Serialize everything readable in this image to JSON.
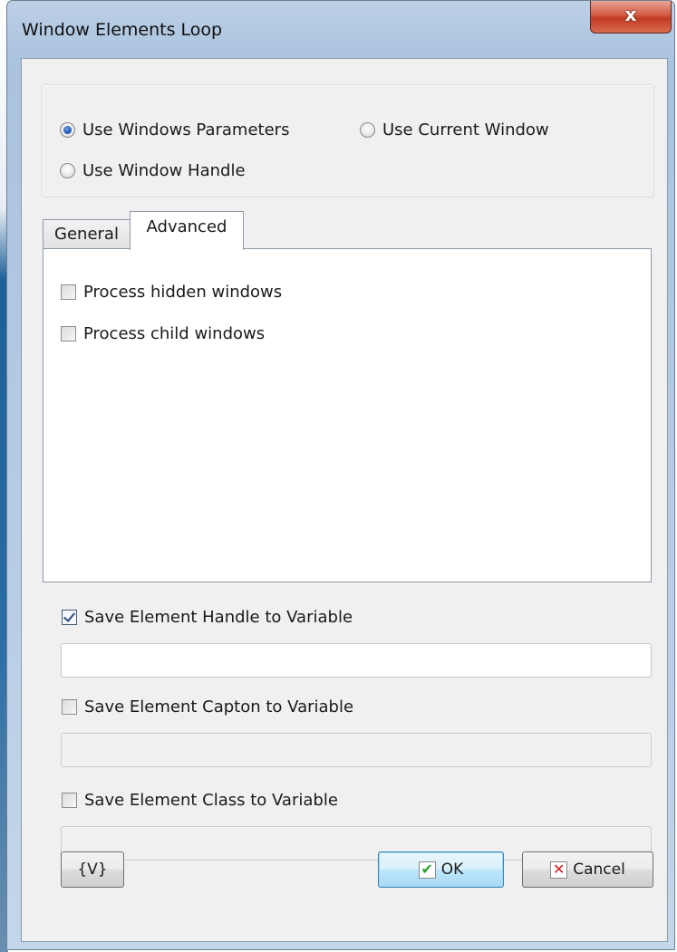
{
  "window": {
    "title": "Window Elements Loop",
    "close_label": "x"
  },
  "mode": {
    "options": [
      {
        "label": "Use Windows Parameters",
        "checked": true
      },
      {
        "label": "Use Current Window",
        "checked": false
      },
      {
        "label": "Use Window Handle",
        "checked": false
      }
    ]
  },
  "tabs": [
    {
      "label": "General",
      "active": false
    },
    {
      "label": "Advanced",
      "active": true
    }
  ],
  "advanced": {
    "options": [
      {
        "label": "Process hidden windows",
        "checked": false
      },
      {
        "label": "Process child windows",
        "checked": false
      }
    ]
  },
  "save": {
    "handle": {
      "label": "Save Element Handle to Variable",
      "checked": true,
      "value": ""
    },
    "caption": {
      "label": "Save Element Capton to Variable",
      "checked": false,
      "value": ""
    },
    "class": {
      "label": "Save Element Class to Variable",
      "checked": false,
      "value": ""
    }
  },
  "buttons": {
    "variables": "{V}",
    "ok": "OK",
    "cancel": "Cancel"
  },
  "icons": {
    "ok": "checkmark-icon",
    "cancel": "red-x-icon"
  },
  "colors": {
    "accent": "#1f58b4",
    "ok_icon": "#2a9d2a",
    "cancel_icon": "#d21c1c",
    "close_button": "#c23a22"
  }
}
